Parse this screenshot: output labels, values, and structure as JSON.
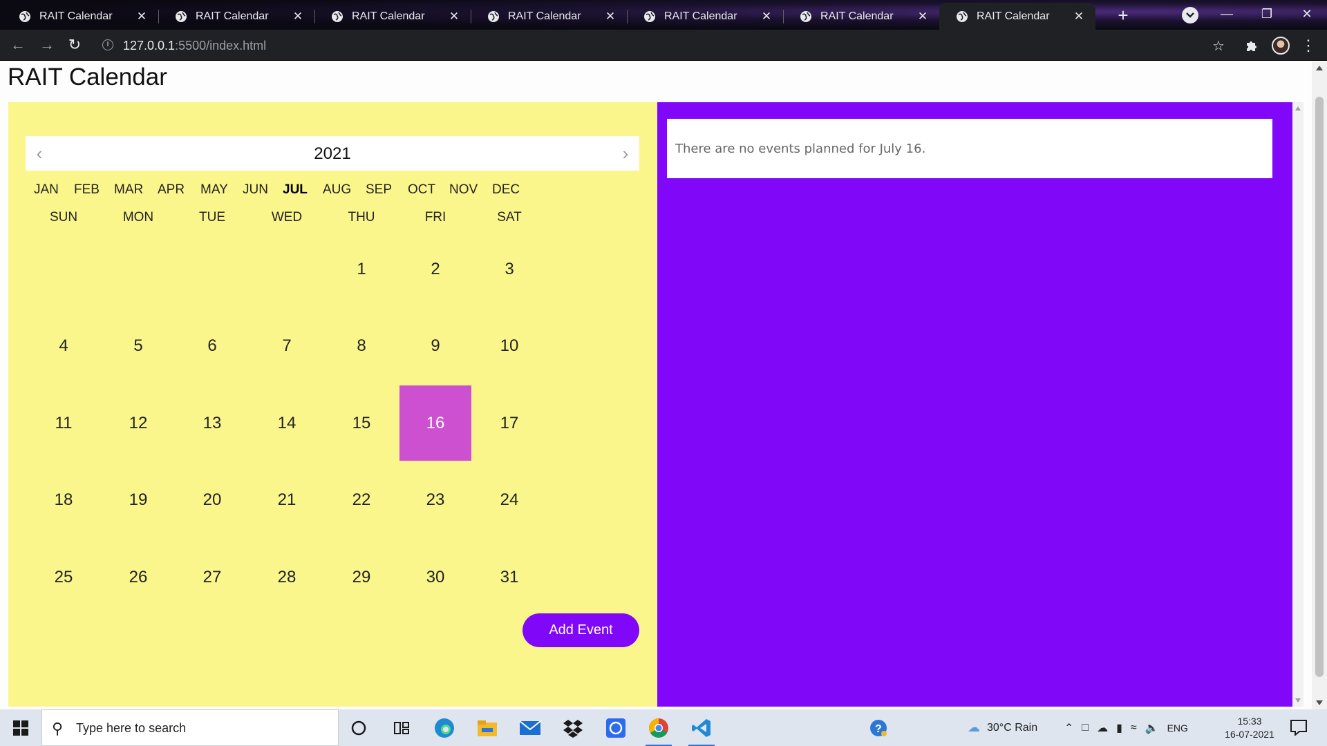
{
  "browser": {
    "tabs": [
      {
        "title": "RAIT Calendar"
      },
      {
        "title": "RAIT Calendar"
      },
      {
        "title": "RAIT Calendar"
      },
      {
        "title": "RAIT Calendar"
      },
      {
        "title": "RAIT Calendar"
      },
      {
        "title": "RAIT Calendar"
      },
      {
        "title": "RAIT Calendar",
        "active": true
      }
    ],
    "url_host": "127.0.0.1",
    "url_rest": ":5500/index.html"
  },
  "page": {
    "title": "RAIT Calendar",
    "calendar": {
      "year": "2021",
      "months": [
        "JAN",
        "FEB",
        "MAR",
        "APR",
        "MAY",
        "JUN",
        "JUL",
        "AUG",
        "SEP",
        "OCT",
        "NOV",
        "DEC"
      ],
      "current_month": "JUL",
      "weekdays": [
        "SUN",
        "MON",
        "TUE",
        "WED",
        "THU",
        "FRI",
        "SAT"
      ],
      "weeks": [
        [
          "",
          "",
          "",
          "",
          "1",
          "2",
          "3"
        ],
        [
          "4",
          "5",
          "6",
          "7",
          "8",
          "9",
          "10"
        ],
        [
          "11",
          "12",
          "13",
          "14",
          "15",
          "16",
          "17"
        ],
        [
          "18",
          "19",
          "20",
          "21",
          "22",
          "23",
          "24"
        ],
        [
          "25",
          "26",
          "27",
          "28",
          "29",
          "30",
          "31"
        ]
      ],
      "selected_day": "16",
      "add_event_label": "Add Event"
    },
    "events": {
      "message": "There are no events planned for July 16."
    },
    "colors": {
      "calendar_bg": "#fbf68b",
      "events_bg": "#8007f8",
      "selected_day": "#cd50d0",
      "button": "#8007f8"
    }
  },
  "taskbar": {
    "search_placeholder": "Type here to search",
    "weather": "30°C  Rain",
    "language": "ENG",
    "time": "15:33",
    "date": "16-07-2021",
    "apps": [
      "cortana-icon",
      "task-view-icon",
      "edge-icon",
      "file-explorer-icon",
      "mail-icon",
      "dropbox-icon",
      "signal-icon",
      "chrome-icon",
      "vscode-icon"
    ]
  }
}
